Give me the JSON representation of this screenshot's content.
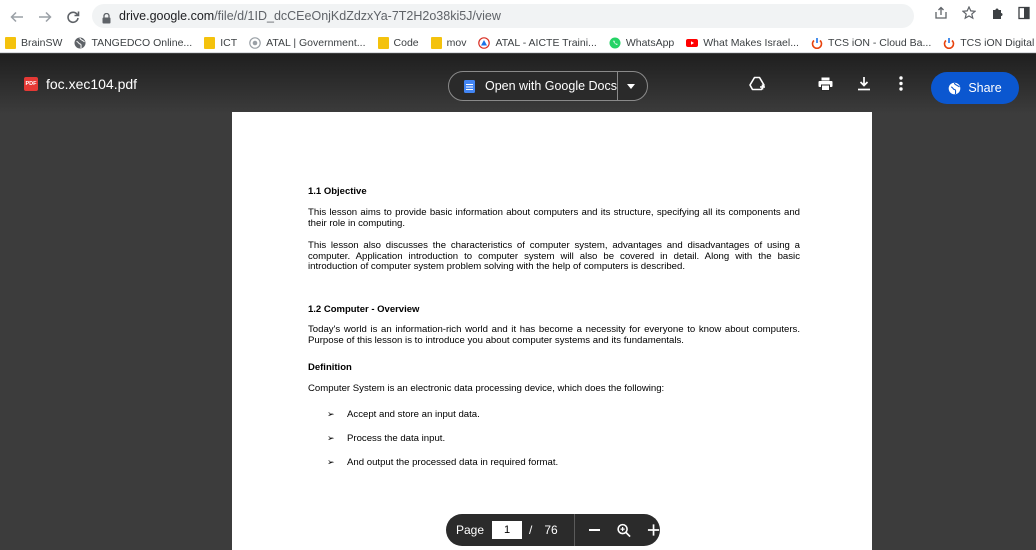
{
  "browser": {
    "url_host": "drive.google.com",
    "url_path": "/file/d/1ID_dcCEeOnjKdZdzxYa-7T2H2o38ki5J/view"
  },
  "bookmarks": [
    {
      "label": "BrainSW",
      "icon": "folder-icon",
      "color": "#f4c20d"
    },
    {
      "label": "TANGEDCO Online...",
      "icon": "globe-icon",
      "color": "#5f6368"
    },
    {
      "label": "ICT",
      "icon": "folder-icon",
      "color": "#f4c20d"
    },
    {
      "label": "ATAL | Government...",
      "icon": "seal-icon",
      "color": "#9aa0a6"
    },
    {
      "label": "Code",
      "icon": "folder-icon",
      "color": "#f4c20d"
    },
    {
      "label": "mov",
      "icon": "folder-icon",
      "color": "#f4c20d"
    },
    {
      "label": "ATAL - AICTE Traini...",
      "icon": "aicte-icon",
      "color": "#d93025"
    },
    {
      "label": "WhatsApp",
      "icon": "whatsapp-icon",
      "color": "#25d366"
    },
    {
      "label": "What Makes Israel...",
      "icon": "youtube-icon",
      "color": "#ff0000"
    },
    {
      "label": "TCS iON - Cloud Ba...",
      "icon": "tcs-ion-icon",
      "color": "#e8430e"
    },
    {
      "label": "TCS iON Digital Lea...",
      "icon": "tcs-ion-icon",
      "color": "#1a73e8"
    }
  ],
  "viewer": {
    "file_name": "foc.xec104.pdf",
    "file_badge": "PDF",
    "open_with_label": "Open with Google Docs",
    "share_label": "Share",
    "share_color": "#0b57d0"
  },
  "document": {
    "h1": "1.1 Objective",
    "p1": "This lesson aims to provide basic information about computers and its structure, specifying all its components and their role in computing.",
    "p2": "This lesson also discusses the characteristics of computer system, advantages and disadvantages of using a computer. Application introduction to computer system will also be covered in detail. Along with the basic introduction of computer system problem solving with the help of computers is described.",
    "h2": "1.2 Computer - Overview",
    "p3": "Today's world is an information-rich world and it has become a necessity for everyone to know about computers. Purpose of this lesson is to introduce you about computer systems and its fundamentals.",
    "h3": "Definition",
    "p4": "Computer System is an electronic data processing device, which does the following:",
    "bullets": [
      "Accept and store an input data.",
      "Process the data input.",
      "And output the processed data in required format."
    ],
    "bullet_glyph": "➢"
  },
  "pager": {
    "label": "Page",
    "current": "1",
    "separator": "/",
    "total": "76"
  }
}
